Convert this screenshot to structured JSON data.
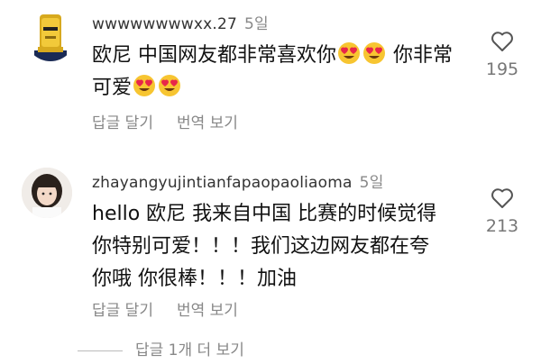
{
  "comments": [
    {
      "username": "wwwwwwwwxx.27",
      "age": "5일",
      "line1_a": "欧尼 中国网友都非常喜欢你",
      "line1_b": " 你非常",
      "line2": "可爱",
      "reply": "답글 달기",
      "translate": "번역 보기",
      "likes": "195",
      "emoji": "heart-eyes-emoji"
    },
    {
      "username": "zhayangyujintianfapaopaoliaoma",
      "age": "5일",
      "line1": "hello 欧尼 我来自中国 比赛的时候觉得",
      "line2": "你特别可爱！！！我们这边网友都在夸",
      "line3": "你哦 你很棒！！！加油",
      "reply": "답글 달기",
      "translate": "번역 보기",
      "likes": "213"
    }
  ],
  "more_replies": "답글 1개 더 보기",
  "colors": {
    "meta": "#888888",
    "text": "#111111",
    "emoji_face": "#F7C531",
    "emoji_heart": "#E8264A"
  }
}
